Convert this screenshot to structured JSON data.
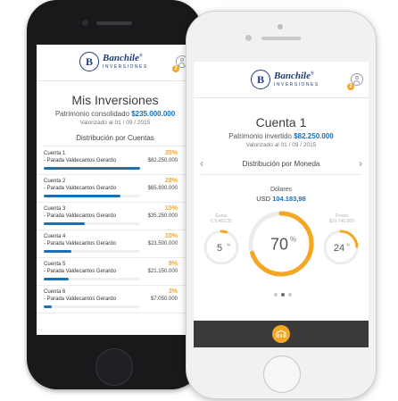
{
  "colors": {
    "accent": "#f5a623",
    "brand_blue": "#1a6fb5",
    "logo_navy": "#1f3c78"
  },
  "brand": {
    "name": "Banchile",
    "sub": "INVERSIONES",
    "seal": "B"
  },
  "header": {
    "notif_count": "2"
  },
  "overview": {
    "title": "Mis Inversiones",
    "patrimonio_label": "Patrimonio consolidado",
    "patrimonio_amount": "$235.000.000",
    "valorizado": "Valorizado al 01 / 09 / 2015",
    "section_title": "Distribución por Cuentas",
    "accounts": [
      {
        "name": "Cuenta 1",
        "owner": "- Parada Valdecantos Gerardo",
        "pct": "35%",
        "pct_value": 35,
        "amount": "$82.250.000"
      },
      {
        "name": "Cuenta 2",
        "owner": "- Parada Valdecantos Gerardo",
        "pct": "28%",
        "pct_value": 28,
        "amount": "$65.800.000"
      },
      {
        "name": "Cuenta 3",
        "owner": "- Parada Valdecantos Gerardo",
        "pct": "15%",
        "pct_value": 15,
        "amount": "$35.250.000"
      },
      {
        "name": "Cuenta 4",
        "owner": "- Parada Valdecantos Gerardo",
        "pct": "10%",
        "pct_value": 10,
        "amount": "$23.500.000"
      },
      {
        "name": "Cuenta 5",
        "owner": "- Parada Valdecantos Gerardo",
        "pct": "9%",
        "pct_value": 9,
        "amount": "$21.150.000"
      },
      {
        "name": "Cuenta 6",
        "owner": "- Parada Valdecantos Gerardo",
        "pct": "3%",
        "pct_value": 3,
        "amount": "$7.050.000"
      }
    ]
  },
  "detail": {
    "title": "Cuenta 1",
    "patrimonio_label": "Patrimonio invertido",
    "patrimonio_amount": "$82.250.000",
    "valorizado": "Valorizado al 01 / 09 / 2015",
    "section_title": "Distribución por Moneda",
    "currencies": {
      "main": {
        "label": "Dólares",
        "code": "USD",
        "amount": "104.183,98",
        "pct": "70",
        "pct_value": 70
      },
      "left": {
        "label": "Euros",
        "amount": "€ 5.483,35",
        "pct": "5",
        "pct_value": 5
      },
      "right": {
        "label": "Pesos",
        "amount": "$19.740.000",
        "pct": "24",
        "pct_value": 24
      }
    },
    "pct_symbol": "%",
    "pager": {
      "count": 3,
      "active": 1
    }
  }
}
